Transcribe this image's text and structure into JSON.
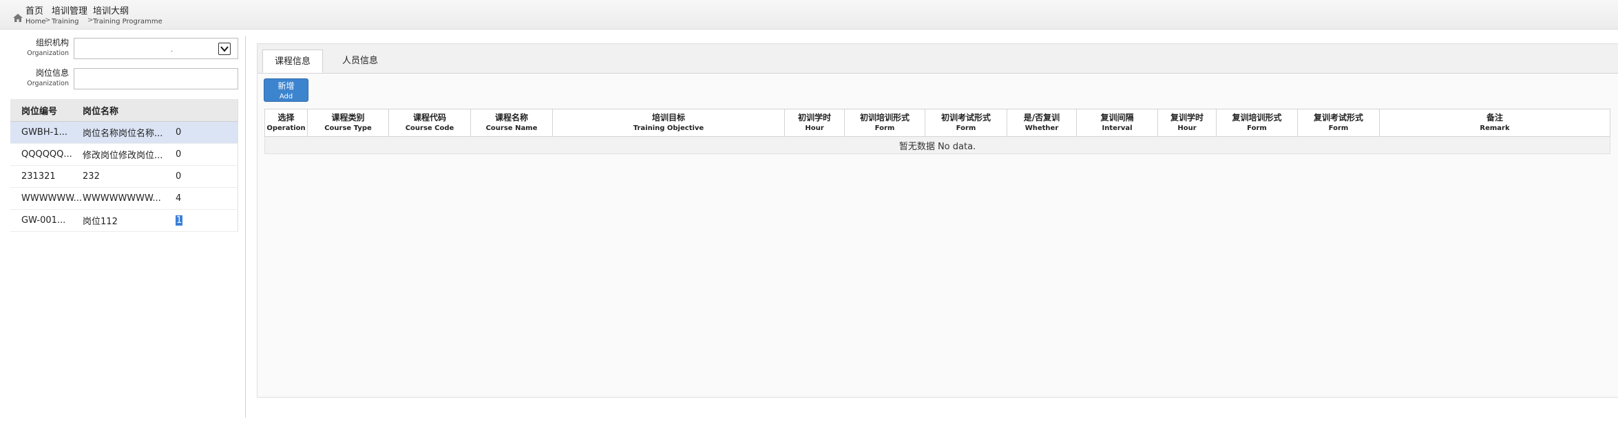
{
  "breadcrumb": [
    {
      "zh": "首页",
      "en": "Home"
    },
    {
      "zh": "培训管理",
      "en": "Training"
    },
    {
      "zh": "培训大纲",
      "en": "Training Programme"
    }
  ],
  "filters": {
    "organization": {
      "label_zh": "组织机构",
      "label_en": "Organization",
      "value": "."
    },
    "position_info": {
      "label_zh": "岗位信息",
      "label_en": "Organization",
      "value": ""
    }
  },
  "position_table": {
    "headers": [
      "岗位编号",
      "岗位名称",
      ""
    ],
    "rows": [
      {
        "code": "GWBH-1...",
        "name": "岗位名称岗位名称...",
        "count": "0"
      },
      {
        "code": "QQQQQQ...",
        "name": "修改岗位修改岗位...",
        "count": "0"
      },
      {
        "code": "231321",
        "name": "232",
        "count": "0"
      },
      {
        "code": "WWWWWW...",
        "name": "WWWWWWWW...",
        "count": "4"
      },
      {
        "code": "GW-001...",
        "name": "岗位112",
        "count": "1"
      }
    ]
  },
  "tabs": [
    {
      "label": "课程信息",
      "active": true
    },
    {
      "label": "人员信息",
      "active": false
    }
  ],
  "add_button": {
    "zh": "新增",
    "en": "Add"
  },
  "course_table": {
    "columns": [
      {
        "zh": "选择",
        "en": "Operation"
      },
      {
        "zh": "课程类别",
        "en": "Course Type"
      },
      {
        "zh": "课程代码",
        "en": "Course Code"
      },
      {
        "zh": "课程名称",
        "en": "Course Name"
      },
      {
        "zh": "培训目标",
        "en": "Training Objective"
      },
      {
        "zh": "初训学时",
        "en": "Hour"
      },
      {
        "zh": "初训培训形式",
        "en": "Form"
      },
      {
        "zh": "初训考试形式",
        "en": "Form"
      },
      {
        "zh": "是/否复训",
        "en": "Whether"
      },
      {
        "zh": "复训间隔",
        "en": "Interval"
      },
      {
        "zh": "复训学时",
        "en": "Hour"
      },
      {
        "zh": "复训培训形式",
        "en": "Form"
      },
      {
        "zh": "复训考试形式",
        "en": "Form"
      },
      {
        "zh": "备注",
        "en": "Remark"
      }
    ],
    "empty_text": "暂无数据 No data."
  },
  "colors": {
    "accent": "#3d84cf",
    "selected_row": "#dbe4f4"
  }
}
